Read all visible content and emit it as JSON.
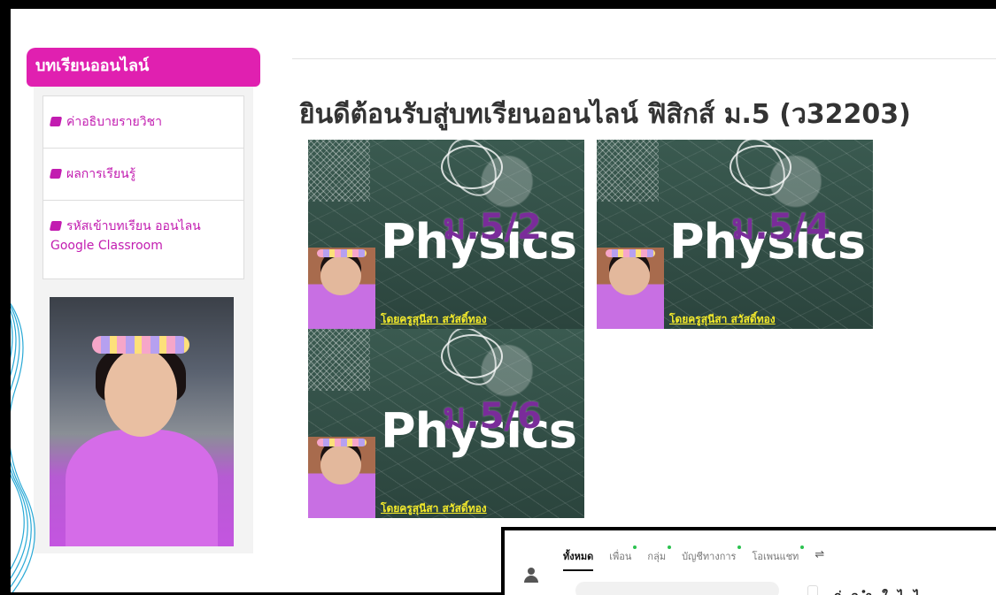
{
  "sidebar": {
    "header": "บทเรียนออนไลน์",
    "items": [
      {
        "label": "ค่าอธิบายรายวิชา"
      },
      {
        "label": "ผลการเรียนรู้"
      },
      {
        "label": "รหัสเข้าบทเรียน ออนไลน Google Classroom"
      }
    ]
  },
  "main": {
    "title": "ยินดีต้อนรับสู่บทเรียนออนไลน์ ฟิสิกส์ ม.5 (ว32203)",
    "cards": [
      {
        "word": "Physics",
        "class_label": "ม.5/2",
        "byline": "โดยครูสุนีสา สวัสดิ์ทอง"
      },
      {
        "word": "Physics",
        "class_label": "ม.5/4",
        "byline": "โดยครูสุนีสา สวัสดิ์ทอง"
      },
      {
        "word": "Physics",
        "class_label": "ม.5/6",
        "byline": "โดยครูสุนีสา สวัสดิ์ทอง"
      }
    ]
  },
  "chat": {
    "tabs": [
      {
        "label": "ทั้งหมด",
        "active": true,
        "dot": false
      },
      {
        "label": "เพื่อน",
        "active": false,
        "dot": true
      },
      {
        "label": "กลุ่ม",
        "active": false,
        "dot": true
      },
      {
        "label": "บัญชีทางการ",
        "active": false,
        "dot": true
      },
      {
        "label": "โอเพนแชท",
        "active": false,
        "dot": true
      }
    ],
    "filter_icon": "sliders-icon",
    "snippet": "ก่ อ ำ ใ ไ ไ"
  },
  "colors": {
    "accent": "#e020b0",
    "link": "#c21cb0",
    "frame": "#000000"
  }
}
